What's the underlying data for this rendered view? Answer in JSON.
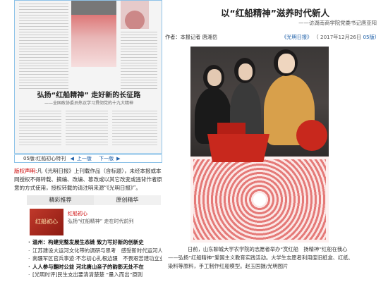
{
  "left": {
    "newspaper": {
      "headline": "弘扬“红船精神” 走好新的长征路",
      "subhead": "——全国政协委员热议学习贯彻党的十九大精神"
    },
    "page_nav": {
      "page_label": "05版:红船初心特刊",
      "prev": "上一版",
      "next": "下一版"
    },
    "copyright": {
      "label": "版权声明:",
      "text": "凡《光明日报》上刊载作品（含标题），未经本报或本网授权不得转载、摘编、改编、篡改或以其它改变或违背作者原意的方式使用，授权转载的请注明来源“《光明日报》”。"
    },
    "tabs": [
      {
        "label": "精彩推荐"
      },
      {
        "label": "原创精华"
      }
    ],
    "feature": {
      "thumb_text": "红船初心",
      "title": "红船初心",
      "subtitle": "弘扬“红船精神” 走在时代前列"
    },
    "news": [
      {
        "text": "温州：构建完整发展生态链 致力写好新的创新史",
        "bold": true
      },
      {
        "text": "江苏建设大运河文化带的调研与思考　感受新时代运河人",
        "bold": false
      },
      {
        "text": "南疆军区官兵事迹:不忘初心扎根边疆　不畏艰苦建功立业",
        "bold": false
      },
      {
        "text": "人人参与翻时公益 河北唐山亲子的韵影无处不在",
        "bold": true
      },
      {
        "text": "[光明时评]民生支出要清清楚楚 “量入而出”原则",
        "bold": false,
        "tag": "[光明时评]"
      }
    ]
  },
  "article": {
    "title": "以“红船精神”滋养时代新人",
    "subtitle": "——访湖南商学院党委书记唐亚阳",
    "byline": "作者：本报记者  唐湘岳",
    "source_link": "《光明日报》",
    "source_date": "（ 2017年12月26日",
    "source_page": "05版）",
    "caption_lines": [
      "日前，山东聊城大学农学院的志愿者举办“赏红船　扬精神”红船在我心",
      "——弘扬“红船精神”爱国主义教育实践活动。大学生志愿者利用废旧纸盒、红纸、",
      "染料等原料，手工制作红船模型。赵玉国摄/光明图片"
    ]
  }
}
